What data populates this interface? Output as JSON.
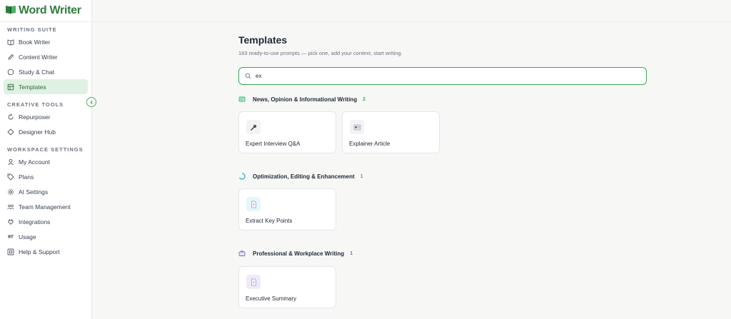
{
  "brand": {
    "name": "Word Writer"
  },
  "sidebar": {
    "sections": [
      {
        "title": "WRITING SUITE",
        "items": [
          {
            "label": "Book Writer",
            "icon": "book-icon"
          },
          {
            "label": "Content Writer",
            "icon": "pen-icon"
          },
          {
            "label": "Study & Chat",
            "icon": "chat-icon"
          },
          {
            "label": "Templates",
            "icon": "template-icon",
            "active": true
          }
        ]
      },
      {
        "title": "CREATIVE TOOLS",
        "items": [
          {
            "label": "Repurposer",
            "icon": "refresh-icon"
          },
          {
            "label": "Designer Hub",
            "icon": "palette-icon"
          }
        ]
      },
      {
        "title": "WORKSPACE SETTINGS",
        "items": [
          {
            "label": "My Account",
            "icon": "user-icon"
          },
          {
            "label": "Plans",
            "icon": "tag-icon"
          },
          {
            "label": "AI Settings",
            "icon": "gear-icon"
          },
          {
            "label": "Team Management",
            "icon": "team-icon"
          },
          {
            "label": "Integrations",
            "icon": "plug-icon"
          },
          {
            "label": "Usage",
            "icon": "usage-icon"
          },
          {
            "label": "Help & Support",
            "icon": "help-icon"
          }
        ]
      }
    ]
  },
  "page": {
    "title": "Templates",
    "subtitle": "183 ready-to-use prompts — pick one, add your context, start writing."
  },
  "search": {
    "value": "ex",
    "placeholder": ""
  },
  "groups": [
    {
      "name": "News, Opinion & Informational Writing",
      "count": "2",
      "icon": "newspaper-icon",
      "accent": "#2bb673",
      "cards": [
        {
          "label": "Expert Interview Q&A",
          "icon": "microphone-icon"
        },
        {
          "label": "Explainer Article",
          "icon": "article-icon"
        }
      ]
    },
    {
      "name": "Optimization, Editing & Enhancement",
      "count": "1",
      "icon": "spinner-icon",
      "accent": "#1fb5c9",
      "cards": [
        {
          "label": "Extract Key Points",
          "icon": "document-icon"
        }
      ]
    },
    {
      "name": "Professional & Workplace Writing",
      "count": "1",
      "icon": "briefcase-icon",
      "accent": "#7c6fc4",
      "cards": [
        {
          "label": "Executive Summary",
          "icon": "document-icon"
        }
      ]
    }
  ],
  "colors": {
    "brand": "#2f7d3e",
    "active_bg": "#dff1e3",
    "search_border": "#3fa65a"
  }
}
